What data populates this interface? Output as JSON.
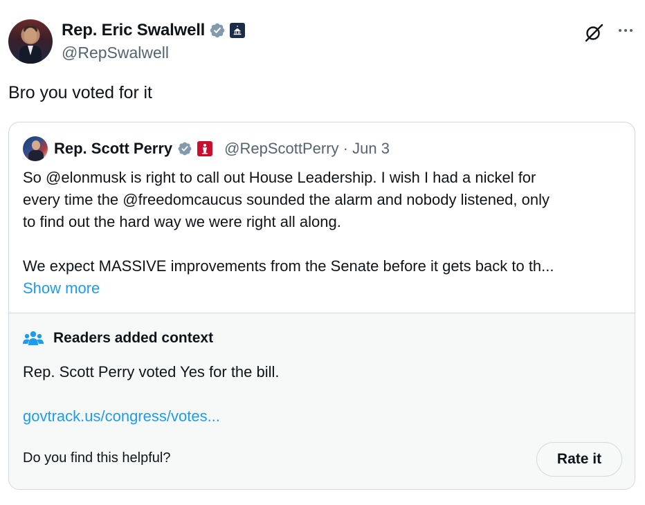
{
  "author": {
    "display_name": "Rep. Eric Swalwell",
    "handle": "@RepSwalwell",
    "verified_icon": "verified-badge-icon",
    "affiliation_icon": "capitol-badge-icon"
  },
  "tweet": {
    "text": "Bro you voted for it"
  },
  "quote": {
    "display_name": "Rep. Scott Perry",
    "handle_date": "@RepScottPerry · Jun 3",
    "lines": [
      "So @elonmusk is right to call out House Leadership.  I wish I had a nickel for",
      "every time the @freedomcaucus sounded the alarm and nobody listened, only",
      "to find out the hard way we were right all along."
    ],
    "line2": "We expect MASSIVE improvements from the Senate before it gets back to th...",
    "show_more": "Show more"
  },
  "context": {
    "title": "Readers added context",
    "text": "Rep. Scott Perry voted Yes for the bill.",
    "link": "govtrack.us/congress/votes...",
    "question": "Do you find this helpful?",
    "rate_label": "Rate it"
  },
  "colors": {
    "text": "#0f1419",
    "secondary": "#536471",
    "link": "#1d9bf0",
    "verified_gray": "#829aab",
    "border": "#cfd9de",
    "context_bg": "#f7f9f9"
  }
}
